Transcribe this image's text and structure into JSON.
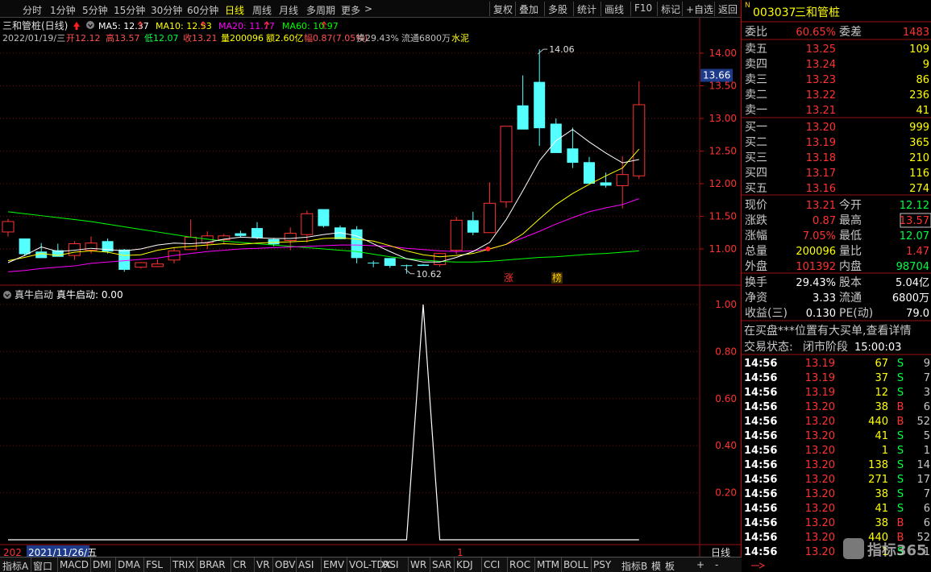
{
  "toolbar": {
    "periods": [
      "分时",
      "1分钟",
      "5分钟",
      "15分钟",
      "30分钟",
      "60分钟",
      "日线",
      "周线",
      "月线",
      "多周期",
      "更多"
    ],
    "active_period": "日线",
    "more_arrow": ">",
    "right_buttons": [
      "复权",
      "叠加",
      "多股",
      "统计",
      "画线",
      "F10",
      "标记",
      "+自选",
      "返回"
    ]
  },
  "chart": {
    "title": "三和管桩(日线)",
    "ma_labels": [
      {
        "text": "MA5: 12.37",
        "color": "#ffffff"
      },
      {
        "text": "MA10: 12.53",
        "color": "#ffff00"
      },
      {
        "text": "MA20: 11.77",
        "color": "#ff00ff"
      },
      {
        "text": "MA60: 10.97",
        "color": "#00ff00"
      }
    ],
    "info": [
      {
        "text": "2022/01/19/三",
        "color": "#c0c0c0"
      },
      {
        "text": "开12.12",
        "color": "#ff5050"
      },
      {
        "text": "高13.57",
        "color": "#ff5050"
      },
      {
        "text": "低12.07",
        "color": "#00ff40"
      },
      {
        "text": "收13.21",
        "color": "#ff5050"
      },
      {
        "text": "量200096",
        "color": "#ffff00"
      },
      {
        "text": "额2.60亿",
        "color": "#ffff00"
      },
      {
        "text": "幅0.87(7.05%)",
        "color": "#ff5050"
      },
      {
        "text": "换29.43%",
        "color": "#c0c0c0"
      },
      {
        "text": "流通6800万",
        "color": "#c0c0c0"
      },
      {
        "text": "水泥",
        "color": "#ffff00"
      }
    ],
    "price_ticks": [
      "14.00",
      "13.50",
      "13.00",
      "12.50",
      "12.00",
      "11.50",
      "11.00"
    ],
    "current_price_tag": "13.66",
    "high_label": "14.06",
    "low_label": "10.62",
    "markers": [
      "涨",
      "榜"
    ],
    "indicator_title": "真牛启动",
    "indicator_value": "真牛启动: 0.00",
    "indicator_ticks": [
      "1.00",
      "0.80",
      "0.60",
      "0.40",
      "0.20"
    ],
    "date_cursor": "2021/11/26/五",
    "date_left": "202",
    "date_mid": "1",
    "period_label": "日线"
  },
  "chart_data": {
    "type": "candlestick",
    "ohlc": [
      [
        11.26,
        11.46,
        11.19,
        11.42
      ],
      [
        11.16,
        11.16,
        10.89,
        10.92
      ],
      [
        10.96,
        11.09,
        10.89,
        10.86
      ],
      [
        10.98,
        11.08,
        10.91,
        10.88
      ],
      [
        10.9,
        11.12,
        10.83,
        11.08
      ],
      [
        10.98,
        11.19,
        10.93,
        11.09
      ],
      [
        11.12,
        11.16,
        10.93,
        10.96
      ],
      [
        10.99,
        11.0,
        10.65,
        10.68
      ],
      [
        10.72,
        10.8,
        10.7,
        10.79
      ],
      [
        10.73,
        10.84,
        10.72,
        10.77
      ],
      [
        10.83,
        11.02,
        10.78,
        10.97
      ],
      [
        10.99,
        11.45,
        10.98,
        11.18
      ],
      [
        11.09,
        11.27,
        11.0,
        11.2
      ],
      [
        11.14,
        11.23,
        11.08,
        11.2
      ],
      [
        11.24,
        11.28,
        11.18,
        11.2
      ],
      [
        11.32,
        11.41,
        11.15,
        11.17
      ],
      [
        11.15,
        11.17,
        11.04,
        11.07
      ],
      [
        11.13,
        11.33,
        10.98,
        11.24
      ],
      [
        11.22,
        11.59,
        11.1,
        11.54
      ],
      [
        11.61,
        11.58,
        11.33,
        11.35
      ],
      [
        11.33,
        11.36,
        11.15,
        11.15
      ],
      [
        11.3,
        11.35,
        10.78,
        10.86
      ],
      [
        10.79,
        10.82,
        10.72,
        10.78
      ],
      [
        10.86,
        10.84,
        10.71,
        10.74
      ],
      [
        10.75,
        10.76,
        10.62,
        10.74
      ],
      [
        10.76,
        10.77,
        10.76,
        10.74
      ],
      [
        10.76,
        10.94,
        10.73,
        10.93
      ],
      [
        10.98,
        11.49,
        10.92,
        11.44
      ],
      [
        11.44,
        11.57,
        11.21,
        11.25
      ],
      [
        11.25,
        12.02,
        11.28,
        11.7
      ],
      [
        11.72,
        12.38,
        11.63,
        12.88
      ],
      [
        13.2,
        13.66,
        12.94,
        12.83
      ],
      [
        13.56,
        14.06,
        12.58,
        12.85
      ],
      [
        12.92,
        13.0,
        12.5,
        12.47
      ],
      [
        12.54,
        12.86,
        12.24,
        12.32
      ],
      [
        12.33,
        12.41,
        12.01,
        12.0
      ],
      [
        12.02,
        12.17,
        11.94,
        11.97
      ],
      [
        11.97,
        12.42,
        11.62,
        12.14
      ],
      [
        12.12,
        13.57,
        12.07,
        13.21
      ]
    ],
    "ma5": [
      10.79,
      10.9,
      11.03,
      10.96,
      10.98,
      11.01,
      10.99,
      10.97,
      11.0,
      11.06,
      11.09,
      11.08,
      11.1,
      11.15,
      11.18,
      11.17,
      11.16,
      11.16,
      11.18,
      11.22,
      11.25,
      11.2,
      11.08,
      10.96,
      10.85,
      10.8,
      10.8,
      10.87,
      10.96,
      11.1,
      11.45,
      11.89,
      12.35,
      12.66,
      12.83,
      12.64,
      12.47,
      12.32,
      12.37
    ],
    "ma10": [
      10.82,
      10.87,
      10.93,
      10.9,
      10.95,
      10.97,
      10.95,
      10.9,
      10.91,
      10.98,
      11.02,
      11.04,
      11.06,
      11.08,
      11.07,
      11.09,
      11.1,
      11.11,
      11.12,
      11.16,
      11.17,
      11.15,
      11.12,
      11.05,
      10.97,
      10.91,
      10.88,
      10.9,
      10.93,
      11.0,
      11.07,
      11.23,
      11.46,
      11.68,
      11.85,
      11.99,
      12.12,
      12.24,
      12.53
    ],
    "ma20": [
      10.65,
      10.67,
      10.7,
      10.72,
      10.74,
      10.78,
      10.8,
      10.82,
      10.84,
      10.86,
      10.9,
      10.93,
      10.96,
      10.98,
      11.0,
      11.01,
      11.02,
      11.03,
      11.04,
      11.05,
      11.06,
      11.06,
      11.05,
      11.04,
      11.01,
      10.99,
      10.97,
      10.96,
      10.97,
      11.0,
      11.07,
      11.17,
      11.27,
      11.38,
      11.48,
      11.57,
      11.63,
      11.68,
      11.77
    ],
    "ma60": [
      11.57,
      11.54,
      11.51,
      11.48,
      11.45,
      11.42,
      11.38,
      11.34,
      11.3,
      11.26,
      11.22,
      11.18,
      11.15,
      11.12,
      11.1,
      11.08,
      11.06,
      11.04,
      11.02,
      11.0,
      10.98,
      10.96,
      10.92,
      10.88,
      10.85,
      10.83,
      10.81,
      10.8,
      10.8,
      10.81,
      10.83,
      10.85,
      10.87,
      10.88,
      10.9,
      10.92,
      10.93,
      10.95,
      10.97
    ],
    "ylim": [
      10.45,
      14.35
    ],
    "indicator": {
      "name": "真牛启动",
      "values": [
        0,
        0,
        0,
        0,
        0,
        0,
        0,
        0,
        0,
        0,
        0,
        0,
        0,
        0,
        0,
        0,
        0,
        0,
        0,
        0,
        0,
        0,
        0,
        0,
        0,
        1,
        0,
        0,
        0,
        0,
        0,
        0,
        0,
        0,
        0,
        0,
        0,
        0,
        0
      ],
      "ylim": [
        0,
        1.1
      ]
    },
    "colors": {
      "up": "#ff3232",
      "down": "#54ffff",
      "ma5": "#ffffff",
      "ma10": "#ffff00",
      "ma20": "#ff00ff",
      "ma60": "#00ff00"
    }
  },
  "quote": {
    "code": "003037",
    "name": "三和管桩",
    "wb_label": "委比",
    "wb_value": "60.65%",
    "wc_label": "委差",
    "wc_value": "1483",
    "sells": [
      {
        "label": "卖五",
        "price": "13.25",
        "vol": "109"
      },
      {
        "label": "卖四",
        "price": "13.24",
        "vol": "9"
      },
      {
        "label": "卖三",
        "price": "13.23",
        "vol": "86"
      },
      {
        "label": "卖二",
        "price": "13.22",
        "vol": "236"
      },
      {
        "label": "卖一",
        "price": "13.21",
        "vol": "41"
      }
    ],
    "buys": [
      {
        "label": "买一",
        "price": "13.20",
        "vol": "999"
      },
      {
        "label": "买二",
        "price": "13.19",
        "vol": "365"
      },
      {
        "label": "买三",
        "price": "13.18",
        "vol": "210"
      },
      {
        "label": "买四",
        "price": "13.17",
        "vol": "116"
      },
      {
        "label": "买五",
        "price": "13.16",
        "vol": "274"
      }
    ],
    "stats": [
      {
        "l1": "现价",
        "v1": "13.21",
        "c1": "#ff3232",
        "l2": "今开",
        "v2": "12.12",
        "c2": "#00ff40"
      },
      {
        "l1": "涨跌",
        "v1": "0.87",
        "c1": "#ff3232",
        "l2": "最高",
        "v2": "13.57",
        "c2": "#ff3232"
      },
      {
        "l1": "涨幅",
        "v1": "7.05%",
        "c1": "#ff3232",
        "l2": "最低",
        "v2": "12.07",
        "c2": "#00ff40"
      },
      {
        "l1": "总量",
        "v1": "200096",
        "c1": "#ffff00",
        "l2": "量比",
        "v2": "1.47",
        "c2": "#ff3232"
      },
      {
        "l1": "外盘",
        "v1": "101392",
        "c1": "#ff3232",
        "l2": "内盘",
        "v2": "98704",
        "c2": "#00ff40"
      }
    ],
    "stats2": [
      {
        "l1": "换手",
        "v1": "29.43%",
        "l2": "股本",
        "v2": "5.04亿"
      },
      {
        "l1": "净资",
        "v1": "3.33",
        "l2": "流通",
        "v2": "6800万"
      },
      {
        "l1": "收益(三)",
        "v1": "0.130",
        "l2": "PE(动)",
        "v2": "79.0"
      }
    ],
    "notice": "在买盘***位置有大买单,查看详情",
    "trade_status_label": "交易状态:",
    "trade_status": "闭市阶段",
    "trade_time": "15:00:03",
    "ticks": [
      {
        "t": "14:56",
        "p": "13.19",
        "v": "67",
        "bs": "S",
        "n": "9"
      },
      {
        "t": "14:56",
        "p": "13.19",
        "v": "37",
        "bs": "S",
        "n": "7"
      },
      {
        "t": "14:56",
        "p": "13.19",
        "v": "12",
        "bs": "S",
        "n": "3"
      },
      {
        "t": "14:56",
        "p": "13.20",
        "v": "38",
        "bs": "B",
        "n": "6"
      },
      {
        "t": "14:56",
        "p": "13.20",
        "v": "440",
        "bs": "B",
        "n": "52"
      },
      {
        "t": "14:56",
        "p": "13.20",
        "v": "41",
        "bs": "S",
        "n": "5"
      },
      {
        "t": "14:56",
        "p": "13.20",
        "v": "1",
        "bs": "S",
        "n": "1"
      },
      {
        "t": "14:56",
        "p": "13.20",
        "v": "138",
        "bs": "S",
        "n": "14"
      },
      {
        "t": "14:56",
        "p": "13.20",
        "v": "271",
        "bs": "S",
        "n": "17"
      },
      {
        "t": "14:56",
        "p": "13.20",
        "v": "38",
        "bs": "S",
        "n": "7"
      },
      {
        "t": "14:56",
        "p": "13.20",
        "v": "41",
        "bs": "S",
        "n": "6"
      },
      {
        "t": "14:56",
        "p": "13.20",
        "v": "38",
        "bs": "B",
        "n": "6"
      },
      {
        "t": "14:56",
        "p": "13.20",
        "v": "440",
        "bs": "B",
        "n": "52"
      },
      {
        "t": "14:56",
        "p": "13.20",
        "v": "1",
        "bs": "S",
        "n": "1"
      }
    ],
    "watermark": "指标365"
  },
  "bottom": {
    "tabs": [
      "指标A",
      "窗口",
      "MACD",
      "DMI",
      "DMA",
      "FSL",
      "TRIX",
      "BRAR",
      "CR",
      "VR",
      "OBV",
      "ASI",
      "EMV",
      "VOL-TDX",
      "RSI",
      "WR",
      "SAR",
      "KDJ",
      "CCI",
      "ROC",
      "MTM",
      "BOLL",
      "PSY"
    ],
    "right_tabs": [
      "指标B",
      "模",
      "板",
      "+",
      "-"
    ]
  }
}
